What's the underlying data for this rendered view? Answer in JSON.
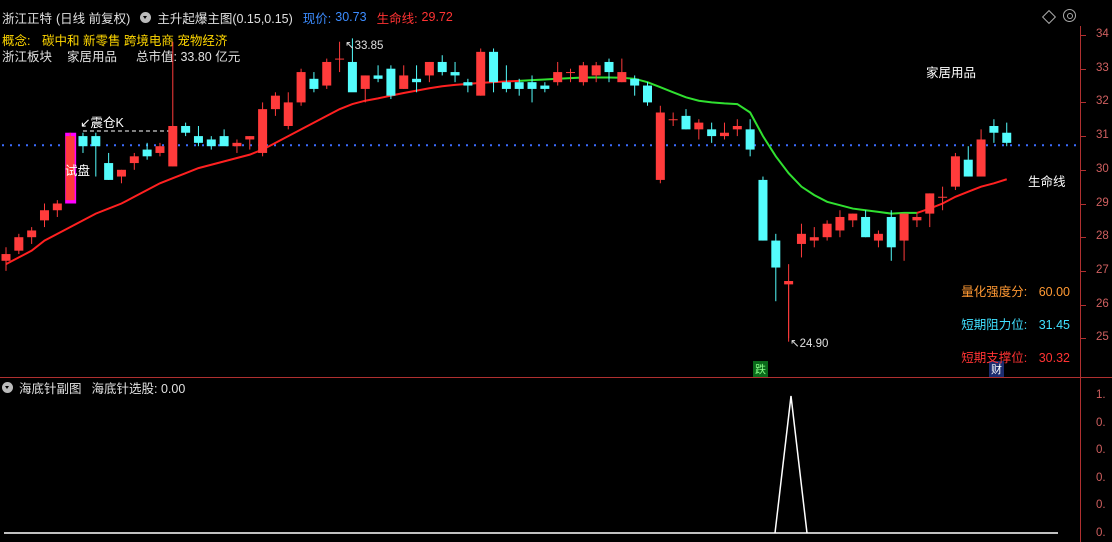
{
  "header": {
    "stock_name": "浙江正特",
    "period": "(日线 前复权)",
    "indicator_name": "主升起爆主图(0.15,0.15)",
    "price_label": "现价:",
    "price_value": "30.73",
    "lifeline_label": "生命线:",
    "lifeline_value": "29.72"
  },
  "concept": {
    "label": "概念:",
    "value": "碳中和 新零售 跨境电商 宠物经济"
  },
  "info_row": {
    "sector": "浙江板块",
    "industry": "家居用品",
    "market_cap": "总市值: 33.80 亿元"
  },
  "chart_annotations": {
    "high_label": "33.85",
    "low_label": "24.90",
    "zhencang": "震仓K",
    "shipan": "试盘",
    "industry_tag": "家居用品",
    "lifeline_tag": "生命线",
    "die_badge": "跌",
    "cai_badge": "财"
  },
  "side_info": {
    "strength_label": "量化强度分:",
    "strength_value": "60.00",
    "resistance_label": "短期阻力位:",
    "resistance_value": "31.45",
    "support_label": "短期支撑位:",
    "support_value": "30.32"
  },
  "price_axis": [
    "34",
    "33",
    "32",
    "31",
    "30",
    "29",
    "28",
    "27",
    "26",
    "25"
  ],
  "sub_panel": {
    "title": "海底针副图",
    "value_text": "海底针选股: 0.00",
    "axis": [
      "1.",
      "0.",
      "0.",
      "0.",
      "0.",
      "0."
    ]
  },
  "colors": {
    "up": "#ff3b3b",
    "down": "#54fcfc",
    "ma_red": "#ff2020",
    "ma_green": "#30e030",
    "magenta": "#ff00ff",
    "dotted": "#3c6cff"
  },
  "candles": [
    [
      27.3,
      27.7,
      27.0,
      27.5
    ],
    [
      27.6,
      28.1,
      27.5,
      28.0
    ],
    [
      28.0,
      28.3,
      27.8,
      28.2
    ],
    [
      28.5,
      29.0,
      28.3,
      28.8
    ],
    [
      28.8,
      29.1,
      28.6,
      29.0
    ],
    [
      29.1,
      31.1,
      29.1,
      31.0
    ],
    [
      31.0,
      31.1,
      30.5,
      30.7
    ],
    [
      31.0,
      31.1,
      29.8,
      30.7
    ],
    [
      30.2,
      30.5,
      29.7,
      29.7
    ],
    [
      29.8,
      30.0,
      29.6,
      30.0
    ],
    [
      30.2,
      30.5,
      30.0,
      30.4
    ],
    [
      30.6,
      30.8,
      30.3,
      30.4
    ],
    [
      30.5,
      30.8,
      30.4,
      30.7
    ],
    [
      30.1,
      33.8,
      30.1,
      31.3
    ],
    [
      31.3,
      31.4,
      31.0,
      31.1
    ],
    [
      31.0,
      31.3,
      30.7,
      30.8
    ],
    [
      30.9,
      31.0,
      30.6,
      30.7
    ],
    [
      31.0,
      31.2,
      30.8,
      30.7
    ],
    [
      30.7,
      30.9,
      30.5,
      30.8
    ],
    [
      30.9,
      31.0,
      30.6,
      31.0
    ],
    [
      30.5,
      32.0,
      30.4,
      31.8
    ],
    [
      31.8,
      32.3,
      31.6,
      32.2
    ],
    [
      31.3,
      32.3,
      31.2,
      32.0
    ],
    [
      32.0,
      33.0,
      31.9,
      32.9
    ],
    [
      32.7,
      32.9,
      32.3,
      32.4
    ],
    [
      32.5,
      33.3,
      32.4,
      33.2
    ],
    [
      33.3,
      33.8,
      32.9,
      33.3
    ],
    [
      33.2,
      33.9,
      32.6,
      32.3
    ],
    [
      32.4,
      32.8,
      32.0,
      32.8
    ],
    [
      32.8,
      33.1,
      32.6,
      32.7
    ],
    [
      33.0,
      33.1,
      32.1,
      32.2
    ],
    [
      32.4,
      33.1,
      32.4,
      32.8
    ],
    [
      32.7,
      33.1,
      32.3,
      32.6
    ],
    [
      32.8,
      33.2,
      32.6,
      33.2
    ],
    [
      33.2,
      33.4,
      32.8,
      32.9
    ],
    [
      32.9,
      33.2,
      32.6,
      32.8
    ],
    [
      32.6,
      32.7,
      32.3,
      32.5
    ],
    [
      32.2,
      33.6,
      32.2,
      33.5
    ],
    [
      33.5,
      33.6,
      32.3,
      32.6
    ],
    [
      32.6,
      33.1,
      32.3,
      32.4
    ],
    [
      32.6,
      32.7,
      32.2,
      32.4
    ],
    [
      32.6,
      32.8,
      32.0,
      32.4
    ],
    [
      32.5,
      32.6,
      32.3,
      32.4
    ],
    [
      32.6,
      33.2,
      32.5,
      32.9
    ],
    [
      32.9,
      33.0,
      32.6,
      32.9
    ],
    [
      32.6,
      33.2,
      32.5,
      33.1
    ],
    [
      32.8,
      33.2,
      32.6,
      33.1
    ],
    [
      33.2,
      33.3,
      32.6,
      32.9
    ],
    [
      32.6,
      33.3,
      32.6,
      32.9
    ],
    [
      32.7,
      32.8,
      32.2,
      32.5
    ],
    [
      32.5,
      32.6,
      31.9,
      32.0
    ],
    [
      29.7,
      31.9,
      29.6,
      31.7
    ],
    [
      31.5,
      31.7,
      31.3,
      31.5
    ],
    [
      31.6,
      31.8,
      31.2,
      31.2
    ],
    [
      31.2,
      31.5,
      30.9,
      31.4
    ],
    [
      31.2,
      31.4,
      30.8,
      31.0
    ],
    [
      31.0,
      31.4,
      30.9,
      31.1
    ],
    [
      31.2,
      31.5,
      31.0,
      31.3
    ],
    [
      31.2,
      31.5,
      30.4,
      30.6
    ],
    [
      29.7,
      29.8,
      27.9,
      27.9
    ],
    [
      27.9,
      28.1,
      26.1,
      27.1
    ],
    [
      26.6,
      27.2,
      25.0,
      26.7
    ],
    [
      27.8,
      28.4,
      27.4,
      28.1
    ],
    [
      27.9,
      28.3,
      27.7,
      28.0
    ],
    [
      28.0,
      28.5,
      27.9,
      28.4
    ],
    [
      28.2,
      28.8,
      28.0,
      28.6
    ],
    [
      28.5,
      28.7,
      28.3,
      28.7
    ],
    [
      28.6,
      28.8,
      28.0,
      28.0
    ],
    [
      27.9,
      28.2,
      27.7,
      28.1
    ],
    [
      28.6,
      28.8,
      27.3,
      27.7
    ],
    [
      27.9,
      28.7,
      27.3,
      28.7
    ],
    [
      28.5,
      28.7,
      28.3,
      28.6
    ],
    [
      28.7,
      29.3,
      28.3,
      29.3
    ],
    [
      29.2,
      29.5,
      28.8,
      29.2
    ],
    [
      29.5,
      30.5,
      29.4,
      30.4
    ],
    [
      30.3,
      30.7,
      29.8,
      29.8
    ],
    [
      29.8,
      31.2,
      29.8,
      30.9
    ],
    [
      31.3,
      31.5,
      30.8,
      31.1
    ],
    [
      31.1,
      31.4,
      30.7,
      30.8
    ]
  ],
  "lifeline": [
    27.2,
    27.4,
    27.6,
    27.9,
    28.1,
    28.3,
    28.5,
    28.7,
    28.85,
    29.0,
    29.2,
    29.4,
    29.6,
    29.75,
    29.9,
    30.05,
    30.15,
    30.25,
    30.35,
    30.45,
    30.6,
    30.8,
    31.0,
    31.2,
    31.4,
    31.6,
    31.8,
    31.95,
    32.05,
    32.12,
    32.2,
    32.28,
    32.35,
    32.42,
    32.48,
    32.52,
    32.55,
    32.58,
    32.6,
    32.62,
    32.64,
    32.66,
    32.68,
    32.7,
    32.72,
    32.74,
    32.74,
    32.74,
    32.73,
    32.7,
    32.6,
    32.45,
    32.3,
    32.15,
    32.05,
    32.0,
    31.97,
    31.95,
    31.7,
    31.0,
    30.4,
    29.9,
    29.5,
    29.25,
    29.05,
    28.95,
    28.85,
    28.8,
    28.75,
    28.7,
    28.72,
    28.72,
    28.85,
    29.0,
    29.2,
    29.35,
    29.5,
    29.6,
    29.72
  ],
  "lifeline_green_range": [
    40,
    71
  ]
}
